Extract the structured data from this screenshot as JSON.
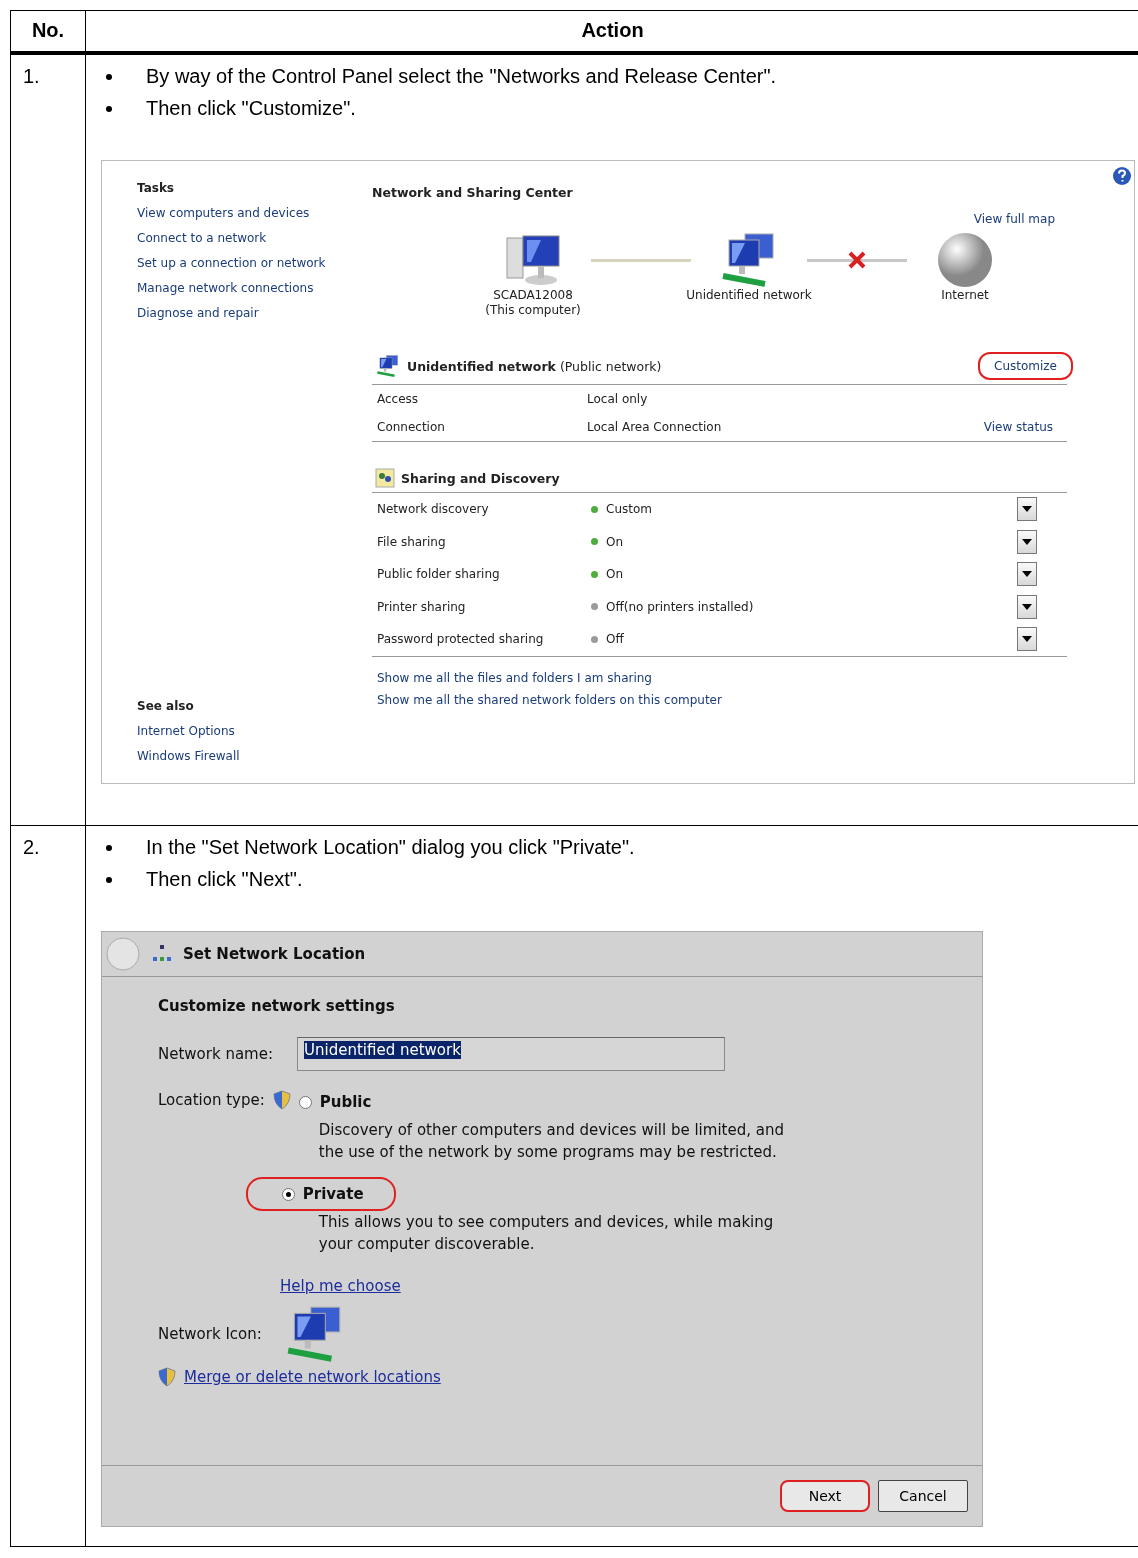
{
  "table": {
    "columns": [
      "No.",
      "Action"
    ],
    "rows": [
      {
        "number": "1.",
        "steps": [
          "By way of the Control Panel select the \"Networks and Release Center\".",
          "Then click \"Customize\"."
        ],
        "screenshot": {
          "kind": "sharing_center",
          "tasks_heading": "Tasks",
          "tasks": [
            "View computers and devices",
            "Connect to a network",
            "Set up a connection or network",
            "Manage network connections",
            "Diagnose and repair"
          ],
          "see_also_heading": "See also",
          "see_also": [
            "Internet Options",
            "Windows Firewall"
          ],
          "title": "Network and Sharing Center",
          "view_full_map": "View full map",
          "map_nodes": [
            {
              "kind": "computer",
              "lines": [
                "SCADA12008",
                "(This computer)"
              ]
            },
            {
              "kind": "network",
              "lines": [
                "Unidentified network"
              ]
            },
            {
              "kind": "internet",
              "lines": [
                "Internet"
              ]
            }
          ],
          "map_links": [
            {
              "broken": false
            },
            {
              "broken": true
            }
          ],
          "network": {
            "name": "Unidentified network",
            "type": "(Public network)",
            "customize": {
              "label": "Customize",
              "highlighted": true
            },
            "details": [
              {
                "label": "Access",
                "value": "Local only"
              },
              {
                "label": "Connection",
                "value": "Local Area Connection",
                "link": "View status"
              }
            ]
          },
          "sharing_title": "Sharing and Discovery",
          "sharing": [
            {
              "label": "Network discovery",
              "status": "Custom",
              "color": "#4caf3c"
            },
            {
              "label": "File sharing",
              "status": "On",
              "color": "#4caf3c"
            },
            {
              "label": "Public folder sharing",
              "status": "On",
              "color": "#4caf3c"
            },
            {
              "label": "Printer sharing",
              "status": "Off(no printers installed)",
              "color": "#9a9a9a"
            },
            {
              "label": "Password protected sharing",
              "status": "Off",
              "color": "#9a9a9a"
            }
          ],
          "links": [
            "Show me all the files and folders I am sharing",
            "Show me all the shared network folders on this computer"
          ]
        }
      },
      {
        "number": "2.",
        "steps": [
          "In the \"Set Network Location\" dialog you click \"Private\".",
          "Then click \"Next\"."
        ],
        "screenshot": {
          "kind": "network_location_dialog",
          "title": "Set Network Location",
          "heading": "Customize network settings",
          "name_label": "Network name:",
          "name_value": "Unidentified network",
          "location_label": "Location type:",
          "options": [
            {
              "label": "Public",
              "description": "Discovery of other computers and devices will be limited, and the use of the network by some programs may be restricted.",
              "selected": false,
              "highlighted": false
            },
            {
              "label": "Private",
              "description": "This allows you to see computers and devices, while making your computer discoverable.",
              "selected": true,
              "highlighted": true
            }
          ],
          "help_link": "Help me choose",
          "icon_label": "Network Icon:",
          "merge_link": "Merge or delete network locations",
          "buttons": [
            {
              "label": "Next",
              "highlighted": true
            },
            {
              "label": "Cancel",
              "highlighted": false
            }
          ]
        }
      }
    ]
  }
}
